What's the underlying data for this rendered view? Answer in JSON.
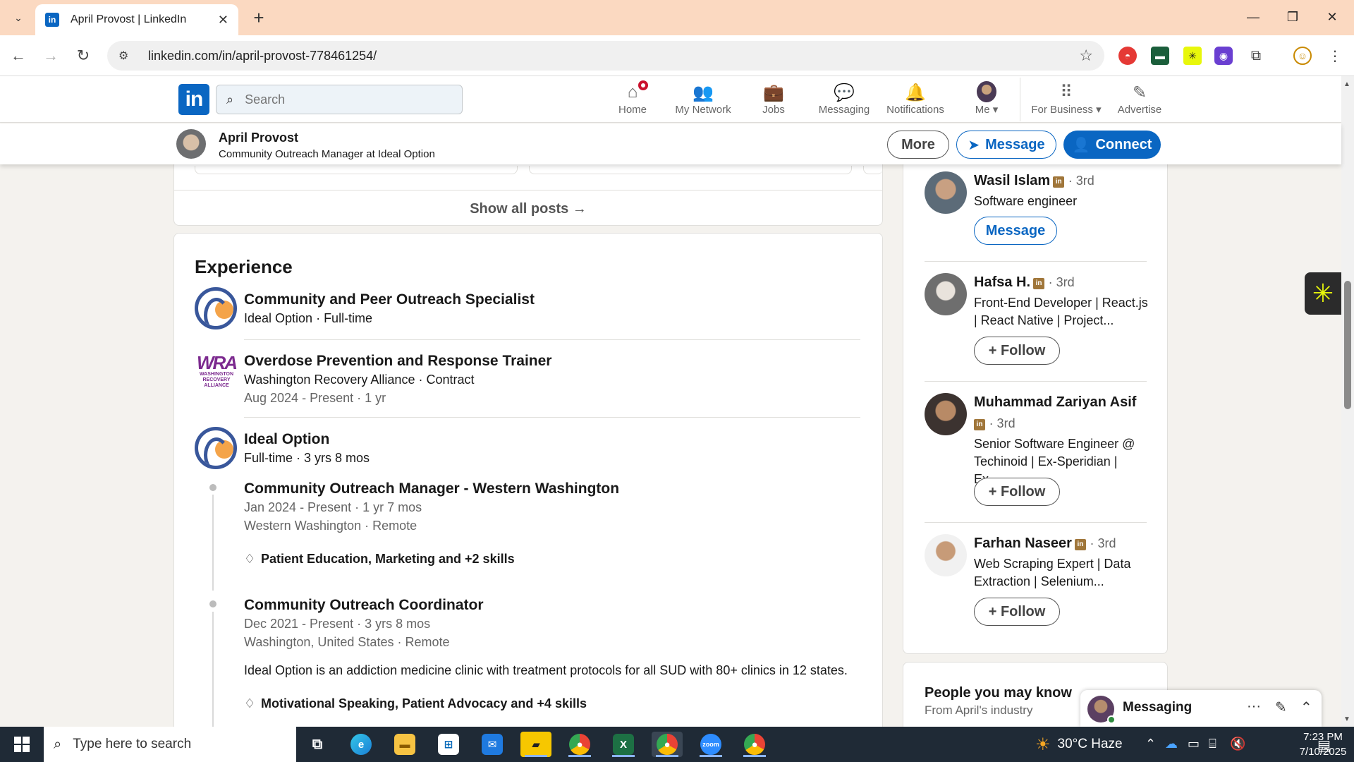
{
  "browser": {
    "tab_title": "April Provost | LinkedIn",
    "favicon_text": "in",
    "url": "linkedin.com/in/april-provost-778461254/"
  },
  "linkedin_nav": {
    "logo_text": "in",
    "search_placeholder": "Search",
    "items": [
      {
        "label": "Home",
        "icon": "home-icon"
      },
      {
        "label": "My Network",
        "icon": "network-icon"
      },
      {
        "label": "Jobs",
        "icon": "briefcase-icon"
      },
      {
        "label": "Messaging",
        "icon": "chat-icon"
      },
      {
        "label": "Notifications",
        "icon": "bell-icon"
      },
      {
        "label": "Me ▾",
        "icon": "avatar"
      },
      {
        "label": "For Business ▾",
        "icon": "grid-icon"
      },
      {
        "label": "Advertise",
        "icon": "compass-icon"
      }
    ]
  },
  "profile_header": {
    "name": "April Provost",
    "headline": "Community Outreach Manager at Ideal Option",
    "more_label": "More",
    "message_label": "Message",
    "connect_label": "Connect"
  },
  "posts": {
    "show_all_label": "Show all posts →"
  },
  "experience": {
    "title": "Experience",
    "entries": [
      {
        "role": "Community and Peer Outreach Specialist",
        "company_line": "Ideal Option · Full-time"
      },
      {
        "logo_main": "WRA",
        "logo_sub": "WASHINGTON RECOVERY ALLIANCE",
        "role": "Overdose Prevention and Response Trainer",
        "company_line": "Washington Recovery Alliance · Contract",
        "dates": "Aug 2024 - Present · 1 yr"
      },
      {
        "company": "Ideal Option",
        "company_line": "Full-time · 3 yrs 8 mos",
        "positions": [
          {
            "role": "Community Outreach Manager - Western Washington",
            "dates": "Jan 2024 - Present · 1 yr 7 mos",
            "location": "Western Washington · Remote",
            "skills": "Patient Education, Marketing and +2 skills"
          },
          {
            "role": "Community Outreach Coordinator",
            "dates": "Dec 2021 - Present · 3 yrs 8 mos",
            "location": "Washington, United States · Remote",
            "description": "Ideal Option is an addiction medicine clinic with treatment protocols for all SUD with 80+ clinics in 12 states.",
            "skills": "Motivational Speaking, Patient Advocacy and +4 skills"
          }
        ]
      }
    ]
  },
  "right_rail": {
    "people": [
      {
        "name": "Wasil Islam",
        "degree": "· 3rd",
        "headline": "Software engineer",
        "action": "Message"
      },
      {
        "name": "Hafsa H.",
        "degree": "· 3rd",
        "headline": "Front-End Developer | React.js | React Native | Project...",
        "action": "+ Follow"
      },
      {
        "name": "Muhammad Zariyan Asif",
        "degree": "· 3rd",
        "headline": "Senior Software Engineer @ Techinoid | Ex-Speridian | Ex-...",
        "action": "+ Follow"
      },
      {
        "name": "Farhan Naseer",
        "degree": "· 3rd",
        "headline": "Web Scraping Expert | Data Extraction | Selenium...",
        "action": "+ Follow"
      }
    ],
    "badge_text": "in",
    "pymk_title": "People you may know",
    "pymk_subtitle": "From April's industry"
  },
  "messaging_dock": {
    "label": "Messaging",
    "more": "···",
    "compose": "✎",
    "expand": "⌃"
  },
  "taskbar": {
    "search_placeholder": "Type here to search",
    "weather": "30°C Haze",
    "time": "7:23 PM",
    "date": "7/10/2025",
    "apps": [
      "task-view",
      "edge",
      "file-explorer",
      "store",
      "mail",
      "sticky-notes",
      "chrome",
      "excel",
      "chrome",
      "zoom",
      "chrome"
    ]
  },
  "colors": {
    "linkedin_blue": "#0a66c2",
    "tabbar": "#fbd9c1",
    "notification_red": "#cb112d"
  }
}
